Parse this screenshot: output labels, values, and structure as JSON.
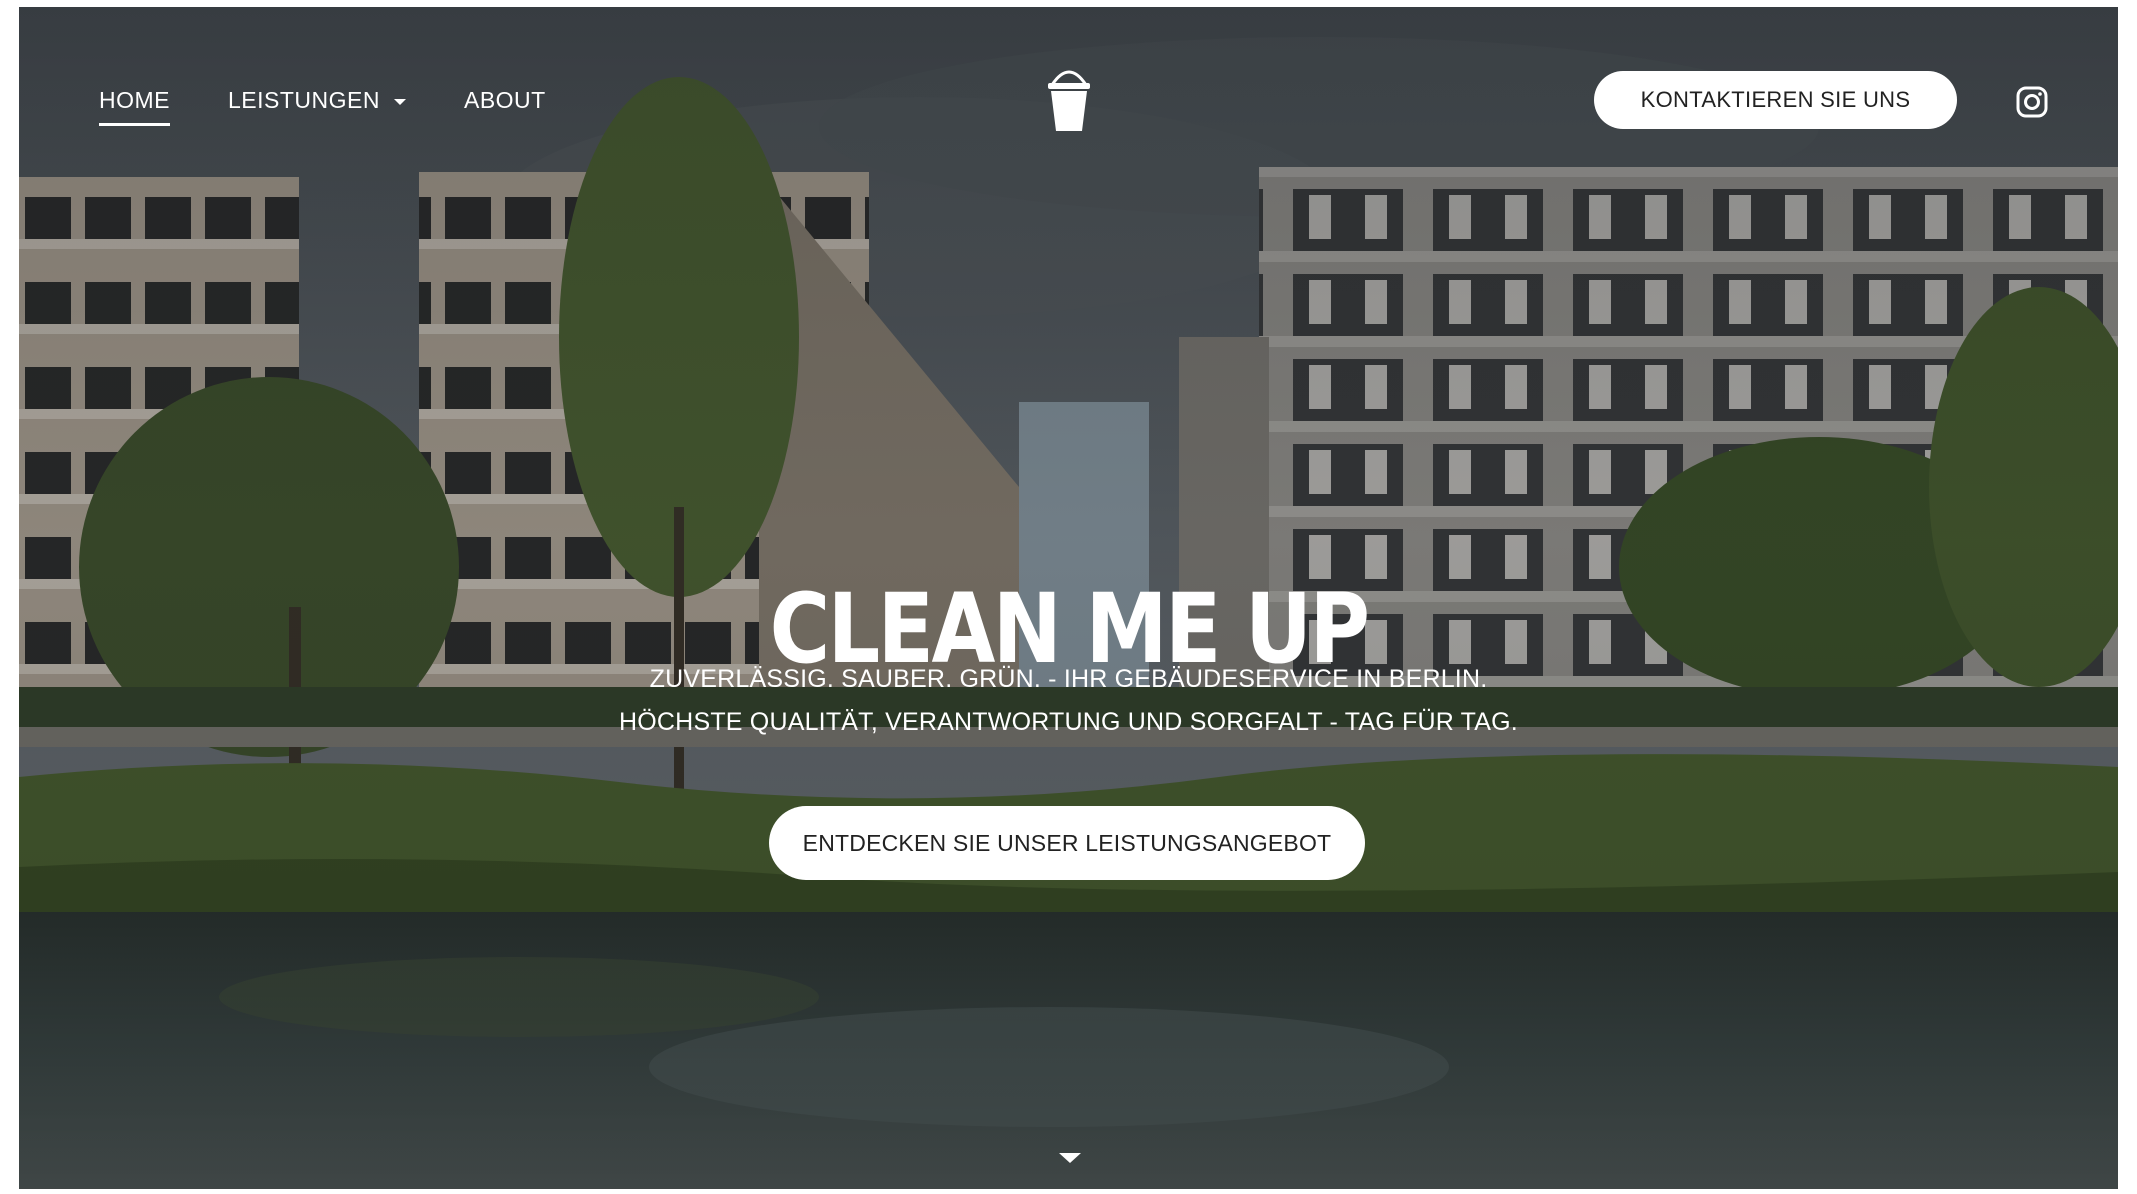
{
  "nav": {
    "items": [
      {
        "label": "HOME",
        "active": true
      },
      {
        "label": "LEISTUNGEN",
        "has_dropdown": true
      },
      {
        "label": "ABOUT"
      }
    ],
    "logo_icon": "bucket-icon",
    "contact_label": "KONTAKTIEREN SIE UNS",
    "social_icon": "instagram-icon"
  },
  "hero": {
    "title": "CLEAN ME UP",
    "subtitle_line1": "ZUVERLÄSSIG. SAUBER. GRÜN. - IHR GEBÄUDESERVICE IN BERLIN.",
    "subtitle_line2": "HÖCHSTE QUALITÄT, VERANTWORTUNG UND SORGFALT - TAG FÜR TAG.",
    "cta_label": "ENTDECKEN SIE UNSER LEISTUNGSANGEBOT",
    "scroll_icon": "caret-down-icon"
  },
  "colors": {
    "text": "#ffffff",
    "button_bg": "#ffffff",
    "button_text": "#222222",
    "overlay": "#14161880"
  }
}
